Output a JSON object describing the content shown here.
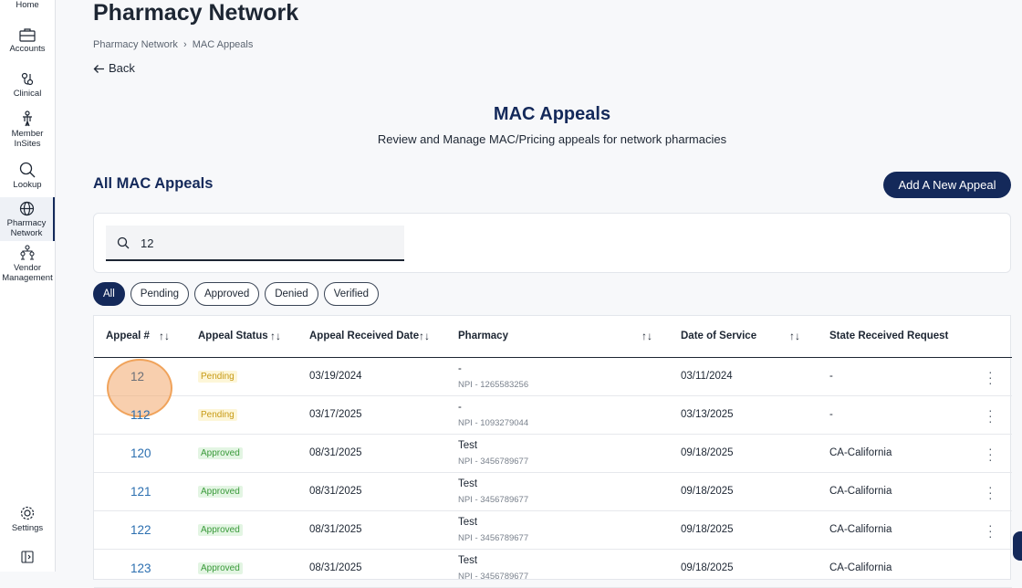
{
  "sidebar": {
    "items": [
      {
        "label": "Home",
        "icon": "home-icon"
      },
      {
        "label": "Accounts",
        "icon": "briefcase-icon"
      },
      {
        "label": "Clinical",
        "icon": "clinical-icon"
      },
      {
        "label": "Member InSites",
        "icon": "member-icon"
      },
      {
        "label": "Lookup",
        "icon": "search-icon"
      },
      {
        "label": "Pharmacy Network",
        "icon": "globe-icon"
      },
      {
        "label": "Vendor Management",
        "icon": "org-chart-icon"
      },
      {
        "label": "Settings",
        "icon": "gear-icon"
      }
    ]
  },
  "page": {
    "title": "Pharmacy Network",
    "breadcrumb": [
      "Pharmacy Network",
      "MAC Appeals"
    ],
    "back_label": "Back",
    "hero_title": "MAC Appeals",
    "hero_subtitle": "Review and Manage MAC/Pricing appeals for network pharmacies",
    "section_title": "All MAC Appeals",
    "add_button": "Add A New Appeal"
  },
  "search": {
    "value": "12"
  },
  "filters": [
    "All",
    "Pending",
    "Approved",
    "Denied",
    "Verified"
  ],
  "table": {
    "headers": [
      "Appeal #",
      "Appeal Status",
      "Appeal Received Date",
      "Pharmacy",
      "Date of Service",
      "State Received Request"
    ],
    "rows": [
      {
        "appeal": "12",
        "status": "Pending",
        "received": "03/19/2024",
        "pharmacy": "-",
        "npi": "NPI - 1265583256",
        "dos": "03/11/2024",
        "state": "-"
      },
      {
        "appeal": "112",
        "status": "Pending",
        "received": "03/17/2025",
        "pharmacy": "-",
        "npi": "NPI - 1093279044",
        "dos": "03/13/2025",
        "state": "-"
      },
      {
        "appeal": "120",
        "status": "Approved",
        "received": "08/31/2025",
        "pharmacy": "Test",
        "npi": "NPI - 3456789677",
        "dos": "09/18/2025",
        "state": "CA-California"
      },
      {
        "appeal": "121",
        "status": "Approved",
        "received": "08/31/2025",
        "pharmacy": "Test",
        "npi": "NPI - 3456789677",
        "dos": "09/18/2025",
        "state": "CA-California"
      },
      {
        "appeal": "122",
        "status": "Approved",
        "received": "08/31/2025",
        "pharmacy": "Test",
        "npi": "NPI - 3456789677",
        "dos": "09/18/2025",
        "state": "CA-California"
      },
      {
        "appeal": "123",
        "status": "Approved",
        "received": "08/31/2025",
        "pharmacy": "Test",
        "npi": "NPI - 3456789677",
        "dos": "09/18/2025",
        "state": "CA-California"
      }
    ]
  },
  "colors": {
    "primary": "#14295a",
    "link": "#2c6fb0",
    "pending": "#c79a15",
    "approved": "#3a9a3a",
    "highlight": "#f0a35b"
  }
}
